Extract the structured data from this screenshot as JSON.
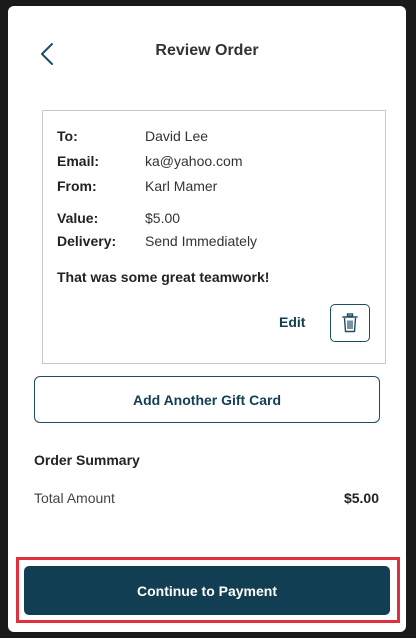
{
  "header": {
    "title": "Review Order",
    "back_icon": "chevron-left-icon"
  },
  "order": {
    "fields": [
      {
        "label": "To:",
        "value": "David Lee"
      },
      {
        "label": "Email:",
        "value": "ka@yahoo.com"
      },
      {
        "label": "From:",
        "value": "Karl Mamer"
      },
      {
        "label": "Value:",
        "value": "$5.00"
      },
      {
        "label": "Delivery:",
        "value": "Send Immediately"
      }
    ],
    "message": "That was some great teamwork!",
    "edit_label": "Edit",
    "delete_icon": "trash-icon"
  },
  "actions": {
    "add_label": "Add Another Gift Card",
    "continue_label": "Continue to Payment"
  },
  "summary": {
    "title": "Order Summary",
    "total_label": "Total Amount",
    "total_value": "$5.00"
  },
  "colors": {
    "primary": "#113e52",
    "highlight": "#e0303d",
    "border": "#c8c8c8"
  }
}
